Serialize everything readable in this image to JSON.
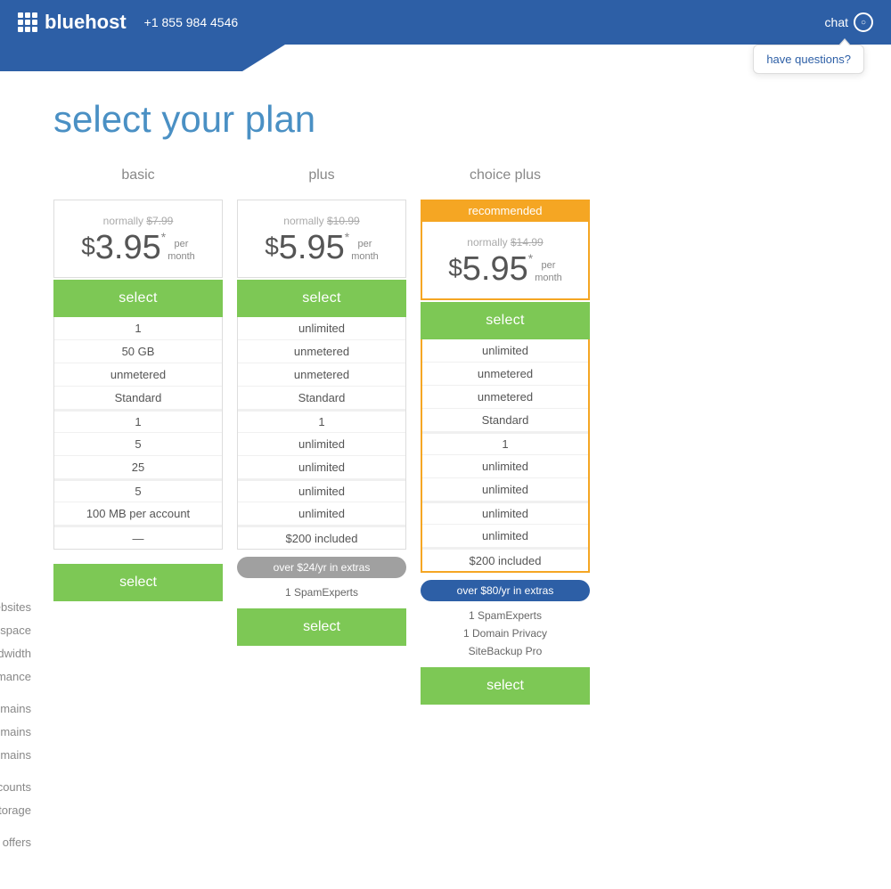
{
  "header": {
    "logo_text": "bluehost",
    "phone": "+1 855 984 4546",
    "chat_label": "chat",
    "tooltip": "have questions?"
  },
  "page": {
    "title": "select your plan"
  },
  "plans": [
    {
      "id": "basic",
      "name": "basic",
      "recommended": false,
      "normally": "normally $7.99",
      "price_whole": "$3.95",
      "price_star": "*",
      "per_month": "per\nmonth",
      "select_top": "select",
      "select_bottom": "select",
      "features": {
        "websites": "1",
        "website_space": "50 GB",
        "bandwidth": "unmetered",
        "performance": "Standard",
        "included_domains": "1",
        "parked_domains": "5",
        "sub_domains": "25",
        "email_accounts": "5",
        "email_storage": "100 MB per account",
        "marketing_offers": "—"
      },
      "extras_badge": null,
      "extras_items": []
    },
    {
      "id": "plus",
      "name": "plus",
      "recommended": false,
      "normally": "normally $10.99",
      "price_whole": "$5.95",
      "price_star": "*",
      "per_month": "per\nmonth",
      "select_top": "select",
      "select_bottom": "select",
      "features": {
        "websites": "unlimited",
        "website_space": "unmetered",
        "bandwidth": "unmetered",
        "performance": "Standard",
        "included_domains": "1",
        "parked_domains": "unlimited",
        "sub_domains": "unlimited",
        "email_accounts": "unlimited",
        "email_storage": "unlimited",
        "marketing_offers": "$200 included"
      },
      "extras_badge": "over $24/yr in extras",
      "extras_badge_type": "gray",
      "extras_items": [
        "1 SpamExperts"
      ]
    },
    {
      "id": "choice-plus",
      "name": "choice plus",
      "recommended": true,
      "recommended_label": "recommended",
      "normally": "normally $14.99",
      "price_whole": "$5.95",
      "price_star": "*",
      "per_month": "per\nmonth",
      "select_top": "select",
      "select_bottom": "select",
      "features": {
        "websites": "unlimited",
        "website_space": "unmetered",
        "bandwidth": "unmetered",
        "performance": "Standard",
        "included_domains": "1",
        "parked_domains": "unlimited",
        "sub_domains": "unlimited",
        "email_accounts": "unlimited",
        "email_storage": "unlimited",
        "marketing_offers": "$200 included"
      },
      "extras_badge": "over $80/yr in extras",
      "extras_badge_type": "blue",
      "extras_items": [
        "1 SpamExperts",
        "1 Domain Privacy",
        "SiteBackup Pro"
      ]
    }
  ],
  "feature_labels": [
    {
      "key": "websites",
      "label": "websites"
    },
    {
      "key": "website_space",
      "label": "website space"
    },
    {
      "key": "bandwidth",
      "label": "bandwidth"
    },
    {
      "key": "performance",
      "label": "performance"
    },
    {
      "key": "included_domains",
      "label": "included domains"
    },
    {
      "key": "parked_domains",
      "label": "parked domains"
    },
    {
      "key": "sub_domains",
      "label": "sub domains"
    },
    {
      "key": "email_accounts",
      "label": "email accounts"
    },
    {
      "key": "email_storage",
      "label": "email storage"
    },
    {
      "key": "marketing_offers",
      "label": "marketing offers"
    }
  ]
}
